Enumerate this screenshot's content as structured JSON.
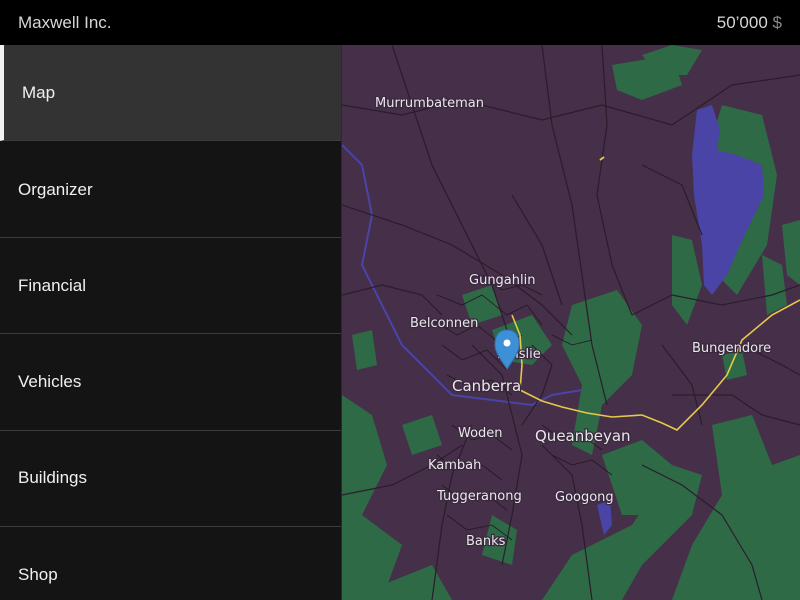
{
  "header": {
    "company_name": "Maxwell Inc.",
    "balance_amount": "50’000",
    "currency_symbol": "$"
  },
  "sidebar": {
    "active_item": "Map",
    "items": [
      {
        "label": "Map"
      },
      {
        "label": "Organizer"
      },
      {
        "label": "Financial"
      },
      {
        "label": "Vehicles"
      },
      {
        "label": "Buildings"
      },
      {
        "label": "Shop"
      }
    ]
  },
  "map": {
    "places": {
      "murrumbateman": "Murrumbateman",
      "gungahlin": "Gungahlin",
      "belconnen": "Belconnen",
      "ainslie": "Ainslie",
      "bungendore": "Bungendore",
      "canberra": "Canberra",
      "woden": "Woden",
      "queanbeyan": "Queanbeyan",
      "kambah": "Kambah",
      "tuggeranong": "Tuggeranong",
      "googong": "Googong",
      "banks": "Banks"
    },
    "marker_icon": "location-pin-icon",
    "colors": {
      "land": "#462f48",
      "forest": "#2e6a46",
      "water": "#4a44a6",
      "major_road": "#e6c84a",
      "roads": "#2a1d2c",
      "marker": "#3d8fd6"
    }
  }
}
